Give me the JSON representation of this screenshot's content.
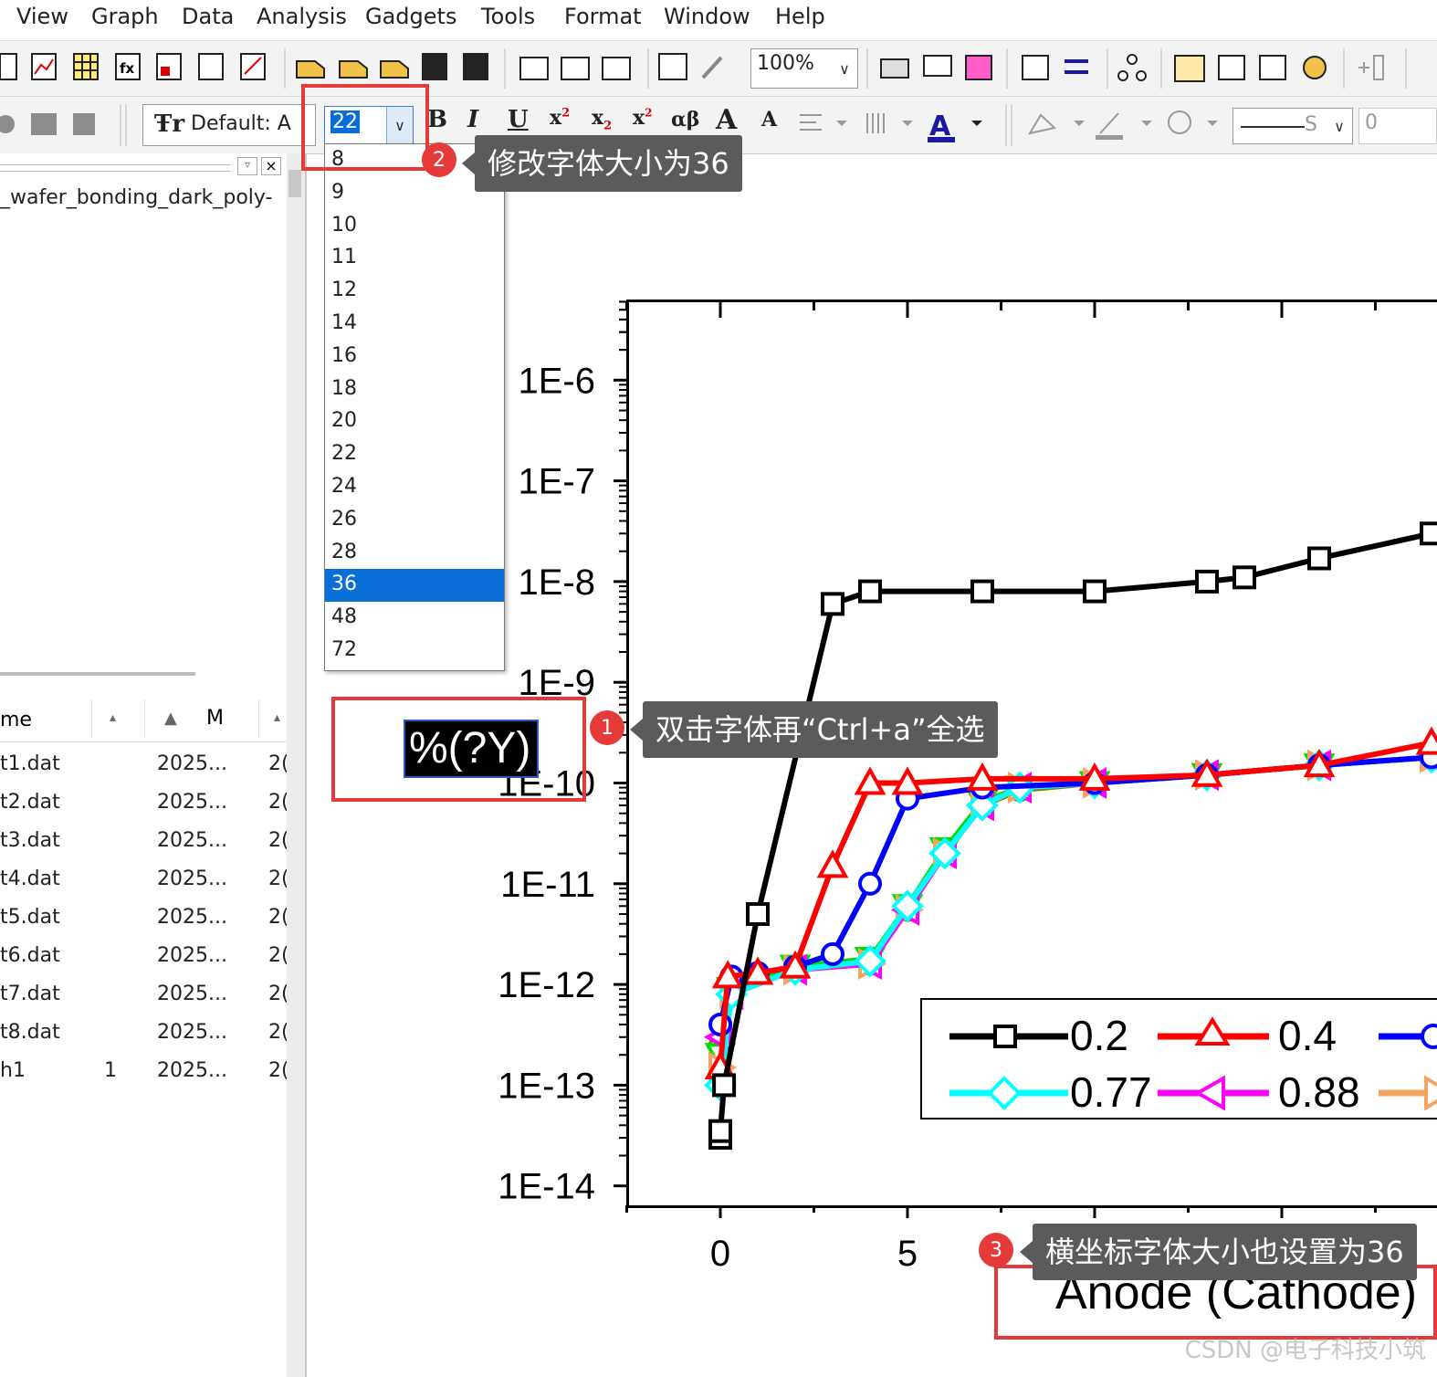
{
  "menu": [
    "View",
    "Graph",
    "Data",
    "Analysis",
    "Gadgets",
    "Tools",
    "Format",
    "Window",
    "Help"
  ],
  "toolbar": {
    "zoom": "100%",
    "font_name": "Default: A",
    "font_size": "22",
    "line_width": "0",
    "line_style_label": "S"
  },
  "fontsize_options": [
    "8",
    "9",
    "10",
    "11",
    "12",
    "14",
    "16",
    "18",
    "20",
    "22",
    "24",
    "26",
    "28",
    "36",
    "48",
    "72"
  ],
  "fontsize_selected": "36",
  "left_panel": {
    "title": "_wafer_bonding_dark_poly-",
    "columns": [
      "me",
      "M"
    ],
    "files": [
      {
        "name": "t1.dat",
        "col2": "",
        "date": "2025...",
        "col4": "2("
      },
      {
        "name": "t2.dat",
        "col2": "",
        "date": "2025...",
        "col4": "2("
      },
      {
        "name": "t3.dat",
        "col2": "",
        "date": "2025...",
        "col4": "2("
      },
      {
        "name": "t4.dat",
        "col2": "",
        "date": "2025...",
        "col4": "2("
      },
      {
        "name": "t5.dat",
        "col2": "",
        "date": "2025...",
        "col4": "2("
      },
      {
        "name": "t6.dat",
        "col2": "",
        "date": "2025...",
        "col4": "2("
      },
      {
        "name": "t7.dat",
        "col2": "",
        "date": "2025...",
        "col4": "2("
      },
      {
        "name": "t8.dat",
        "col2": "",
        "date": "2025...",
        "col4": "2("
      },
      {
        "name": "h1",
        "col2": "1",
        "date": "2025...",
        "col4": "2("
      }
    ]
  },
  "graph": {
    "y_axis_label": "%(?Y)",
    "x_axis_label": "Anode (Cathode)"
  },
  "annotations": {
    "step1": {
      "num": "1",
      "text": "双击字体再“Ctrl+a”全选"
    },
    "step2": {
      "num": "2",
      "text": "修改字体大小为36"
    },
    "step3": {
      "num": "3",
      "text": "横坐标字体大小也设置为36"
    }
  },
  "watermark": "CSDN @电子科技小筑",
  "chart_data": {
    "type": "line",
    "yscale": "log",
    "ylim": [
      1e-14,
      1e-05
    ],
    "xlim": [
      -2.5,
      19
    ],
    "yticks": [
      "1E-14",
      "1E-13",
      "1E-12",
      "1E-11",
      "1E-10",
      "1E-9",
      "1E-8",
      "1E-7",
      "1E-6"
    ],
    "xticks": [
      "0",
      "5"
    ],
    "xlabel": "Anode (Cathode)",
    "ylabel": "%(?Y)",
    "legend_position": "bottom-right",
    "series": [
      {
        "name": "0.2",
        "color": "#000000",
        "marker": "square",
        "x": [
          0,
          0,
          0.1,
          1,
          3,
          4,
          7,
          10,
          13,
          14,
          16,
          19
        ],
        "y": [
          3e-14,
          3.5e-14,
          1e-13,
          5e-12,
          6e-09,
          8e-09,
          8e-09,
          8e-09,
          1e-08,
          1.1e-08,
          1.7e-08,
          3e-08
        ]
      },
      {
        "name": "0.4",
        "color": "#ff0000",
        "marker": "triangle",
        "x": [
          0,
          0.2,
          1,
          2,
          3,
          4,
          5,
          7,
          10,
          13,
          16,
          19
        ],
        "y": [
          1.5e-13,
          1.2e-12,
          1.3e-12,
          1.5e-12,
          1.5e-11,
          1e-10,
          1e-10,
          1.1e-10,
          1.1e-10,
          1.2e-10,
          1.5e-10,
          2.5e-10
        ]
      },
      {
        "name": "",
        "color": "#0000ff",
        "marker": "circle",
        "x": [
          0,
          0.3,
          1,
          2,
          3,
          4,
          5,
          7,
          10,
          13,
          16,
          19
        ],
        "y": [
          4e-13,
          1.2e-12,
          1.3e-12,
          1.5e-12,
          2e-12,
          1e-11,
          7e-11,
          9e-11,
          1e-10,
          1.2e-10,
          1.5e-10,
          1.8e-10
        ]
      },
      {
        "name": "0.77",
        "color": "#00ffff",
        "marker": "diamond",
        "x": [
          0,
          0.3,
          2,
          4,
          5,
          6,
          7,
          8,
          10,
          13,
          16,
          19
        ],
        "y": [
          1e-13,
          8e-13,
          1.4e-12,
          1.7e-12,
          6e-12,
          2e-11,
          6e-11,
          9e-11,
          1e-10,
          1.2e-10,
          1.5e-10,
          1.8e-10
        ]
      },
      {
        "name": "0.88",
        "color": "#ff00ff",
        "marker": "triangle-left",
        "x": [
          0,
          0.3,
          2,
          4,
          5,
          6,
          7,
          8,
          10,
          13,
          16,
          19
        ],
        "y": [
          3e-13,
          8e-13,
          1.4e-12,
          1.6e-12,
          5.5e-12,
          2e-11,
          6e-11,
          9e-11,
          1e-10,
          1.2e-10,
          1.5e-10,
          1.8e-10
        ]
      },
      {
        "name": "",
        "color": "#f4a460",
        "marker": "triangle-right",
        "x": [
          0,
          0.3,
          2,
          4,
          5,
          6,
          7,
          8,
          10,
          13,
          16,
          19
        ],
        "y": [
          1.5e-13,
          8e-13,
          1.4e-12,
          1.6e-12,
          5.5e-12,
          2e-11,
          6e-11,
          9e-11,
          1e-10,
          1.2e-10,
          1.5e-10,
          1.8e-10
        ]
      },
      {
        "name": "",
        "color": "#00dd00",
        "marker": "triangle-down",
        "x": [
          0,
          0.3,
          2,
          4,
          5,
          6,
          7,
          8,
          10,
          13,
          16,
          19
        ],
        "y": [
          2e-13,
          9e-13,
          1.5e-12,
          1.8e-12,
          6e-12,
          2.2e-11,
          6.5e-11,
          9e-11,
          1e-10,
          1.2e-10,
          1.5e-10,
          1.8e-10
        ]
      },
      {
        "name": "",
        "color": "#808000",
        "marker": "circle",
        "x": [
          0,
          0.3,
          2,
          4,
          5,
          6,
          7,
          8,
          10,
          13,
          16,
          19
        ],
        "y": [
          2.5e-13,
          8e-13,
          1.4e-12,
          1.6e-12,
          5.5e-12,
          2e-11,
          6e-11,
          8.5e-11,
          1e-10,
          1.2e-10,
          1.5e-10,
          1.8e-10
        ]
      }
    ]
  }
}
